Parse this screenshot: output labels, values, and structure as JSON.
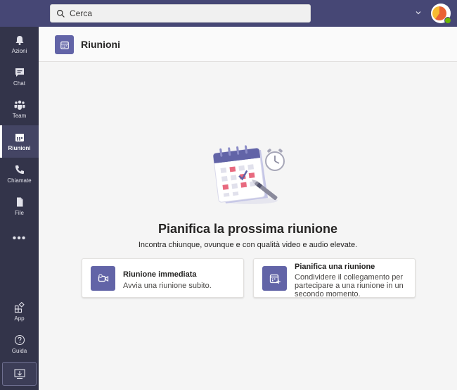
{
  "search": {
    "placeholder": "Cerca"
  },
  "rail": {
    "items": [
      {
        "label": "Azioni",
        "icon": "bell-icon"
      },
      {
        "label": "Chat",
        "icon": "chat-icon"
      },
      {
        "label": "Team",
        "icon": "team-icon"
      },
      {
        "label": "Riunioni",
        "icon": "calendar-icon",
        "active": true
      },
      {
        "label": "Chiamate",
        "icon": "phone-icon"
      },
      {
        "label": "File",
        "icon": "file-icon"
      }
    ],
    "more": "•••",
    "app_label": "App",
    "help_label": "Guida"
  },
  "header": {
    "title": "Riunioni"
  },
  "main": {
    "heading": "Pianifica la prossima riunione",
    "subheading": "Incontra chiunque, ovunque e con qualità video e audio elevate.",
    "cards": [
      {
        "title": "Riunione immediata",
        "description": "Avvia una riunione subito."
      },
      {
        "title": "Pianifica una riunione",
        "description": "Condividere il collegamento per partecipare a una riunione in un secondo momento."
      }
    ]
  },
  "colors": {
    "topbar": "#464775",
    "rail": "#33344a",
    "accent": "#6264a7",
    "presence": "#6bb700"
  }
}
